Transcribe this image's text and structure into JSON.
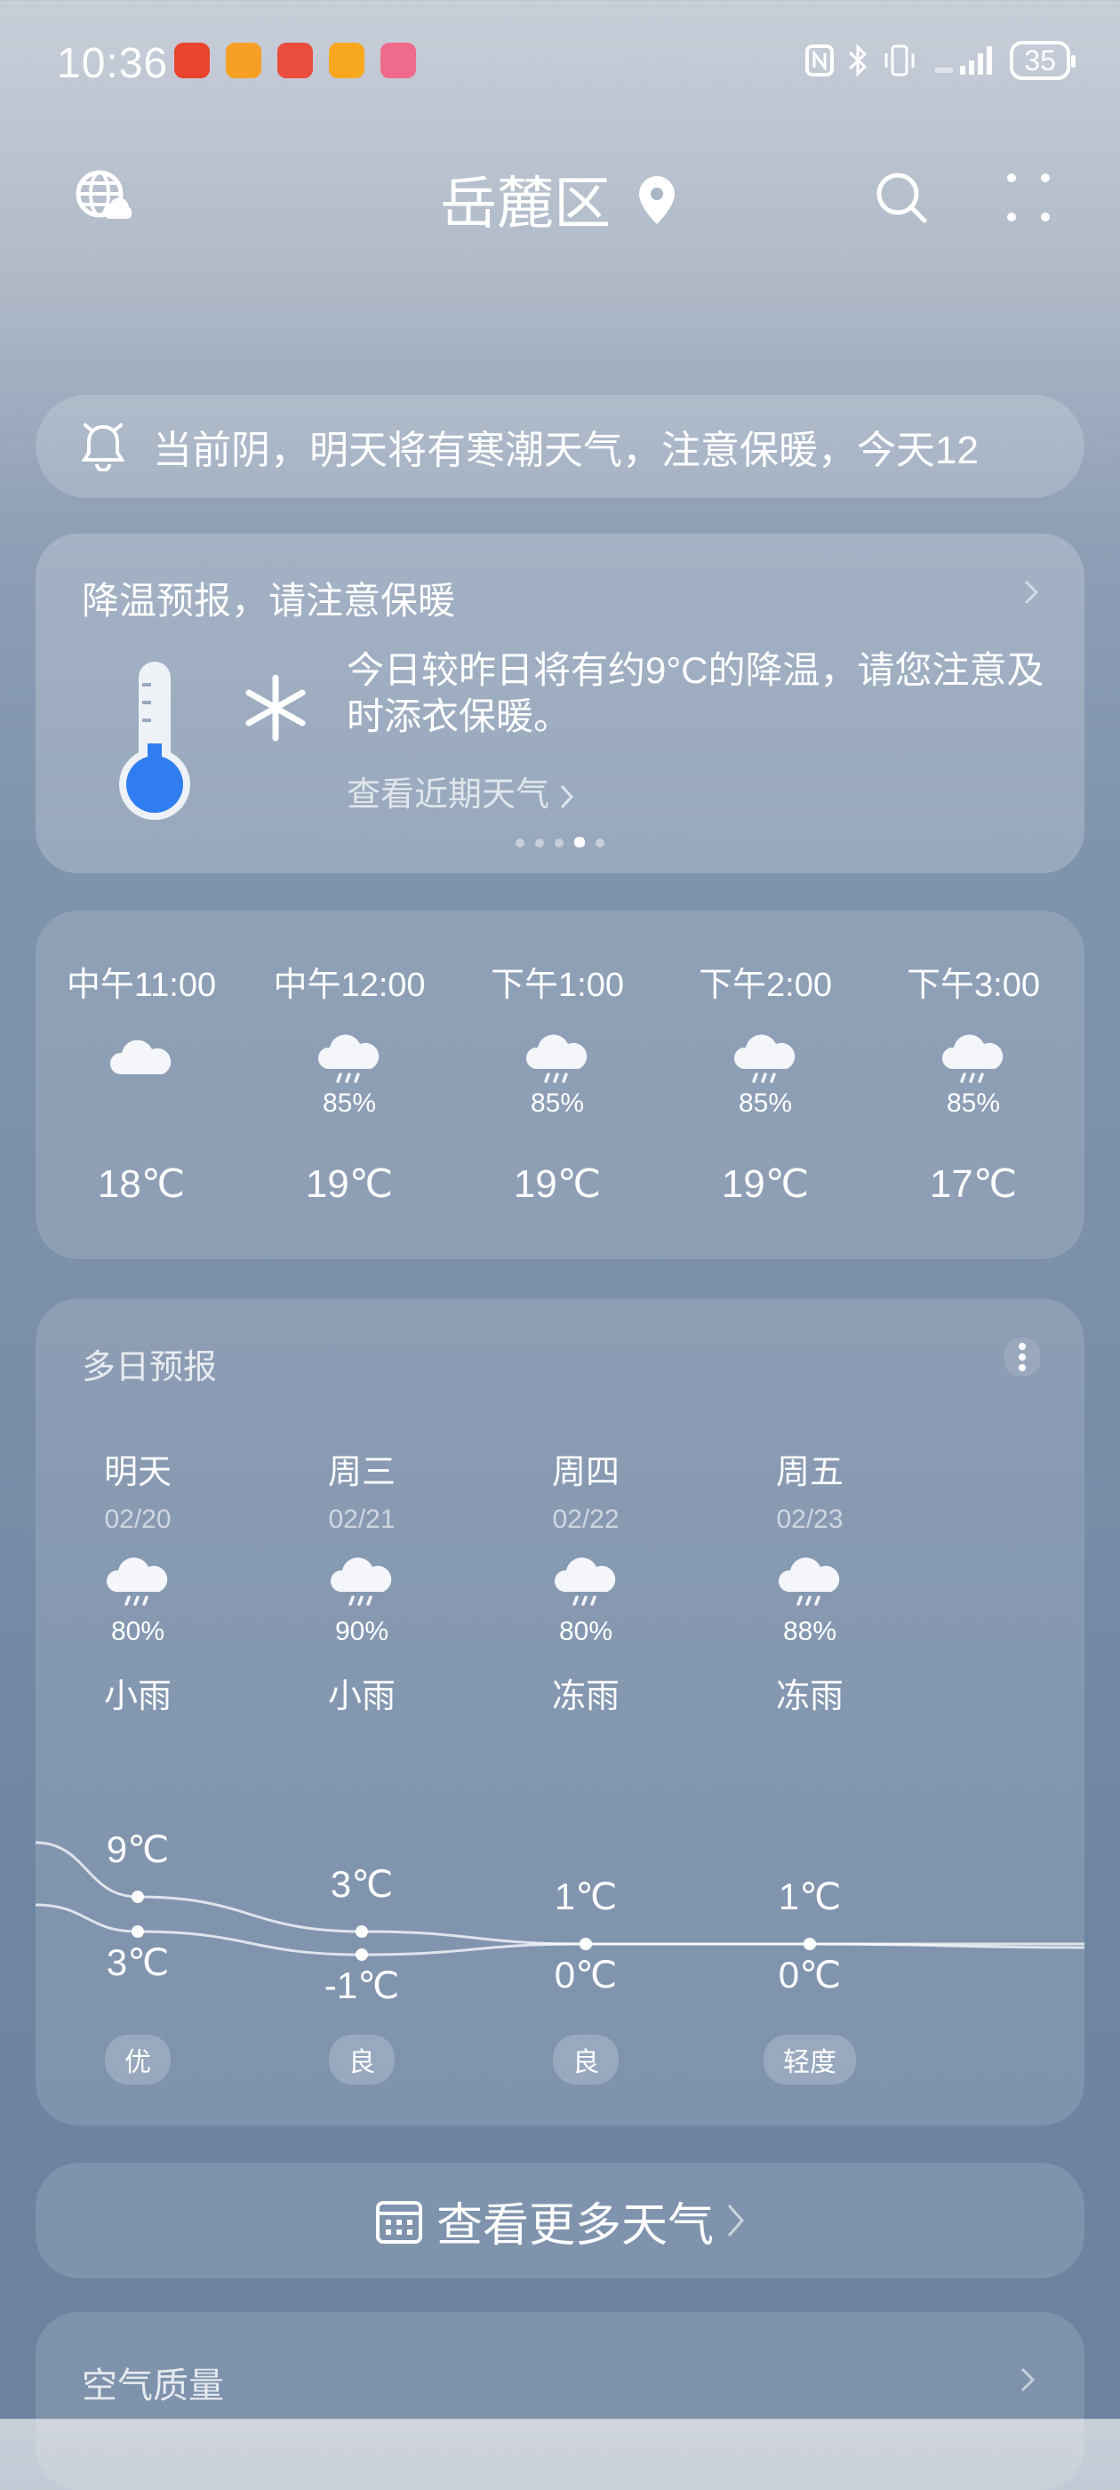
{
  "status_bar": {
    "time": "10:36",
    "battery": "35",
    "app_icons": [
      {
        "name": "taobao-icon",
        "color": "#e8452c"
      },
      {
        "name": "app-icon-orange",
        "color": "#f5a024"
      },
      {
        "name": "app-icon-red",
        "color": "#ea4d3d"
      },
      {
        "name": "app-icon-yellow",
        "color": "#f7a81e"
      },
      {
        "name": "app-icon-pink",
        "color": "#f06a8c"
      }
    ]
  },
  "header": {
    "city": "岳麓区"
  },
  "notice": {
    "text": "当前阴，明天将有寒潮天气，注意保暖，今天12"
  },
  "alert": {
    "title": "降温预报，请注意保暖",
    "description": "今日较昨日将有约9°C的降温，请您注意及时添衣保暖。",
    "link": "查看近期天气",
    "page_count": 5,
    "active_page": 3
  },
  "hourly": [
    {
      "time": "中午11:00",
      "icon": "cloudy-icon",
      "precip": "",
      "temp": "18℃"
    },
    {
      "time": "中午12:00",
      "icon": "rain-cloud-icon",
      "precip": "85%",
      "temp": "19℃"
    },
    {
      "time": "下午1:00",
      "icon": "rain-cloud-icon",
      "precip": "85%",
      "temp": "19℃"
    },
    {
      "time": "下午2:00",
      "icon": "rain-cloud-icon",
      "precip": "85%",
      "temp": "19℃"
    },
    {
      "time": "下午3:00",
      "icon": "rain-cloud-icon",
      "precip": "85%",
      "temp": "17℃"
    }
  ],
  "daily": {
    "title": "多日预报",
    "days": [
      {
        "name": "明天",
        "date": "02/20",
        "icon": "rain-cloud-icon",
        "precip": "80%",
        "weather": "小雨",
        "high": 9,
        "high_label": "9℃",
        "low": 3,
        "low_label": "3℃",
        "aqi": "优"
      },
      {
        "name": "周三",
        "date": "02/21",
        "icon": "rain-cloud-icon",
        "precip": "90%",
        "weather": "小雨",
        "high": 3,
        "high_label": "3℃",
        "low": -1,
        "low_label": "-1℃",
        "aqi": "良"
      },
      {
        "name": "周四",
        "date": "02/22",
        "icon": "rain-cloud-icon",
        "precip": "80%",
        "weather": "冻雨",
        "high": 1,
        "high_label": "1℃",
        "low": 0,
        "low_label": "0℃",
        "aqi": "良"
      },
      {
        "name": "周五",
        "date": "02/23",
        "icon": "rain-cloud-icon",
        "precip": "88%",
        "weather": "冻雨",
        "high": 1,
        "high_label": "1℃",
        "low": 0,
        "low_label": "0℃",
        "aqi": "轻度"
      }
    ]
  },
  "more_weather": {
    "label": "查看更多天气"
  },
  "air_quality": {
    "title": "空气质量"
  }
}
